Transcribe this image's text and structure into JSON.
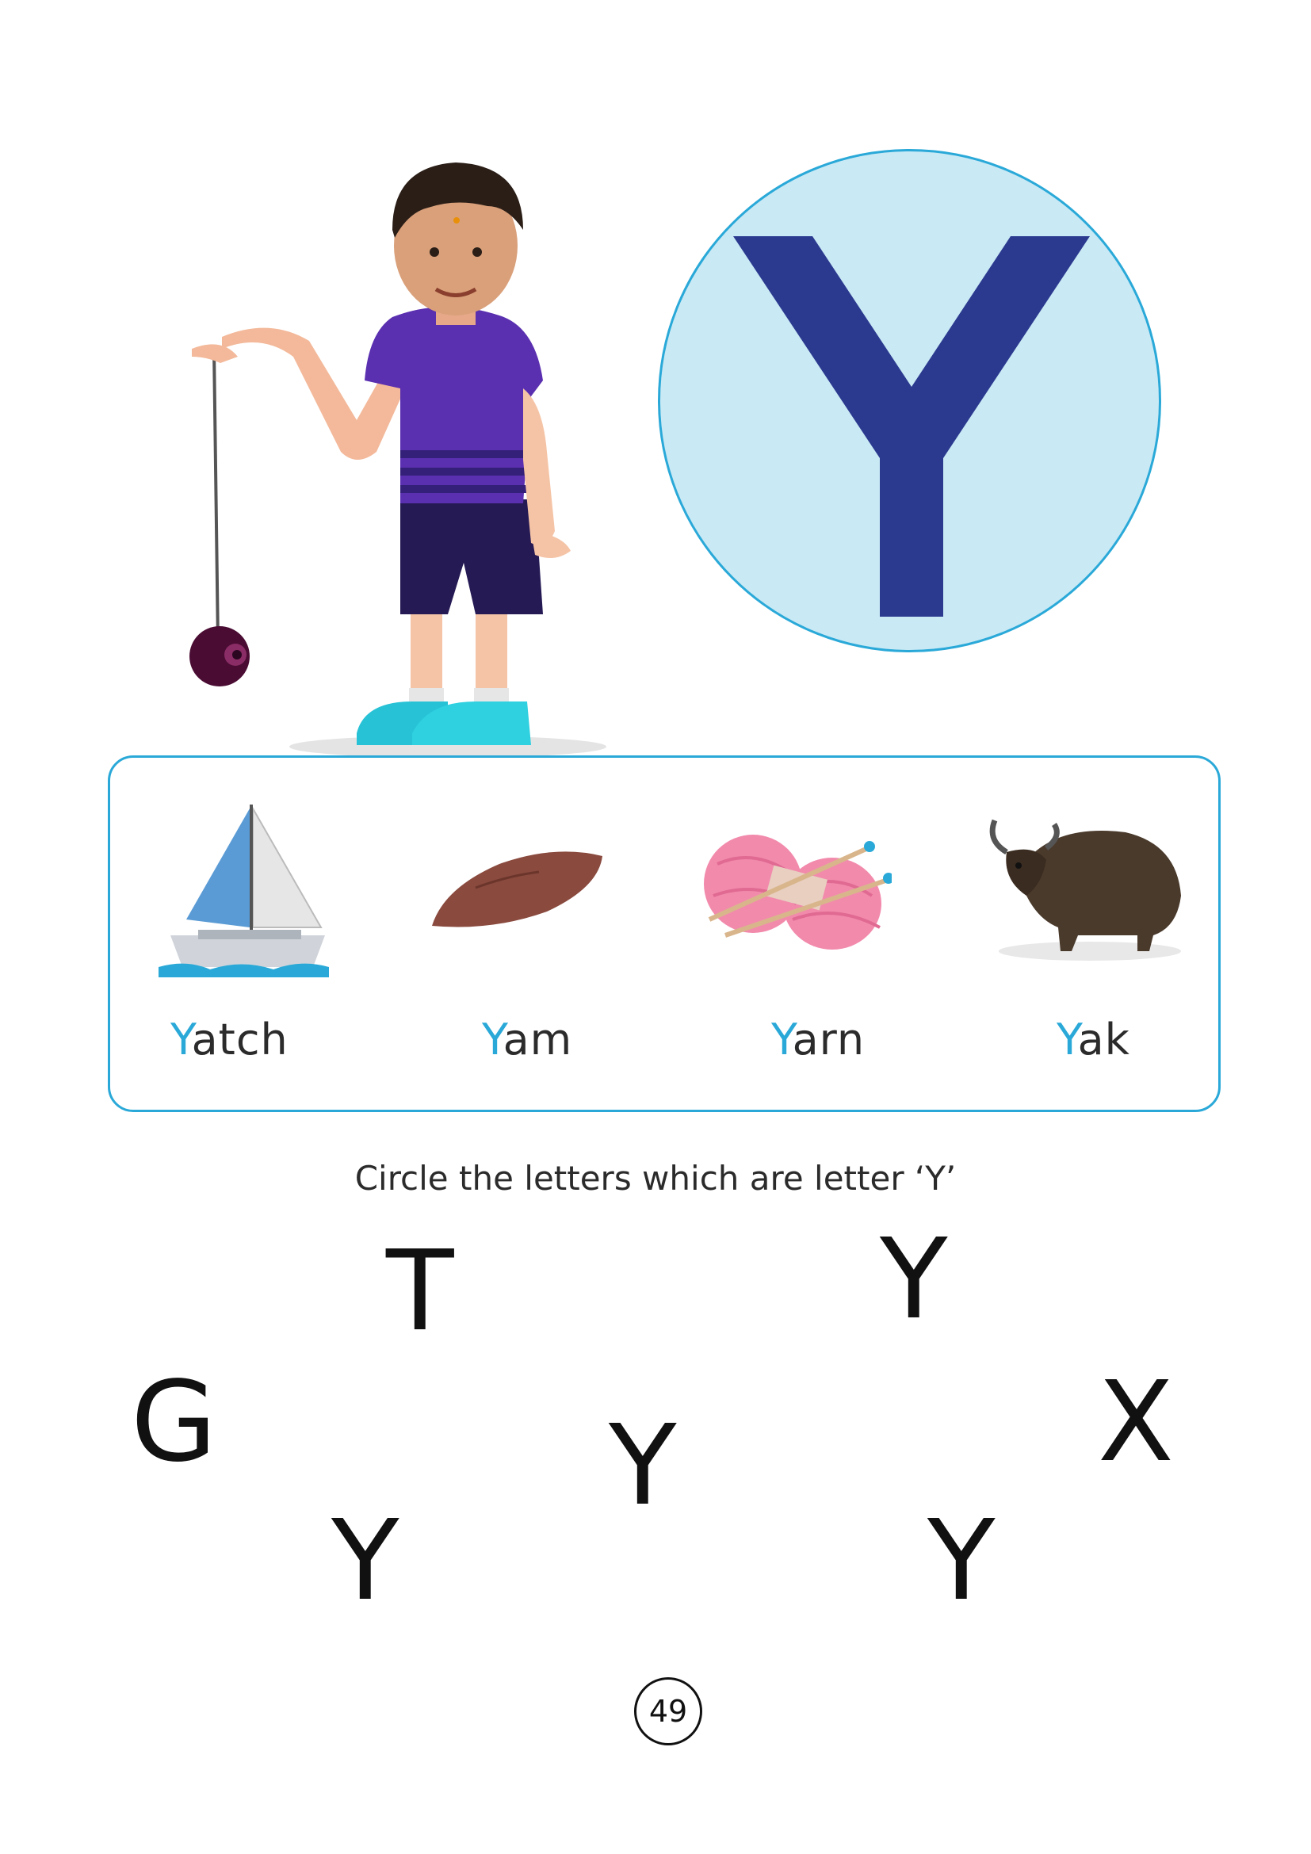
{
  "hero": {
    "letter": "Y",
    "circle_fill": "#c9e9f5",
    "circle_stroke": "#2aa9d8",
    "letter_color": "#2b3a8f"
  },
  "boy_illustration": {
    "description_icon": "boy-with-yoyo-icon"
  },
  "words": [
    {
      "first": "Y",
      "rest": "atch",
      "icon": "sailboat-icon"
    },
    {
      "first": "Y",
      "rest": "am",
      "icon": "sweet-potato-icon"
    },
    {
      "first": "Y",
      "rest": "arn",
      "icon": "yarn-ball-icon"
    },
    {
      "first": "Y",
      "rest": "ak",
      "icon": "yak-icon"
    }
  ],
  "instruction": "Circle the letters which are letter ‘Y’",
  "letters": [
    "T",
    "Y",
    "G",
    "Y",
    "X",
    "Y",
    "Y"
  ],
  "page_number": "49",
  "accent_color": "#2aa9d8"
}
